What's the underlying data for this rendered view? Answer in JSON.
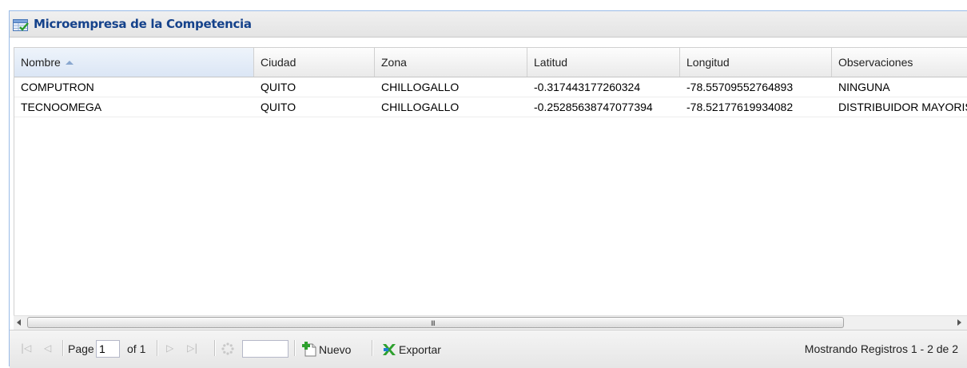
{
  "panel": {
    "title": "Microempresa de la Competencia"
  },
  "grid": {
    "columns": [
      {
        "label": "Nombre",
        "sorted": "asc"
      },
      {
        "label": "Ciudad"
      },
      {
        "label": "Zona"
      },
      {
        "label": "Latitud"
      },
      {
        "label": "Longitud"
      },
      {
        "label": "Observaciones"
      }
    ],
    "rows": [
      [
        "COMPUTRON",
        "QUITO",
        "CHILLOGALLO",
        "-0.317443177260324",
        "-78.55709552764893",
        "NINGUNA"
      ],
      [
        "TECNOOMEGA",
        "QUITO",
        "CHILLOGALLO",
        "-0.25285638747077394",
        "-78.52177619934082",
        "DISTRIBUIDOR MAYORISTA"
      ]
    ]
  },
  "scrollbar": {
    "grip": "III"
  },
  "pager": {
    "page_label": "Page",
    "page_value": "1",
    "of_label": "of 1",
    "page_size_value": "",
    "nuevo_label": "Nuevo",
    "exportar_label": "Exportar",
    "status": "Mostrando Registros 1 - 2 de 2"
  },
  "colors": {
    "title_text": "#15428b",
    "header_border": "#99bbe8"
  }
}
